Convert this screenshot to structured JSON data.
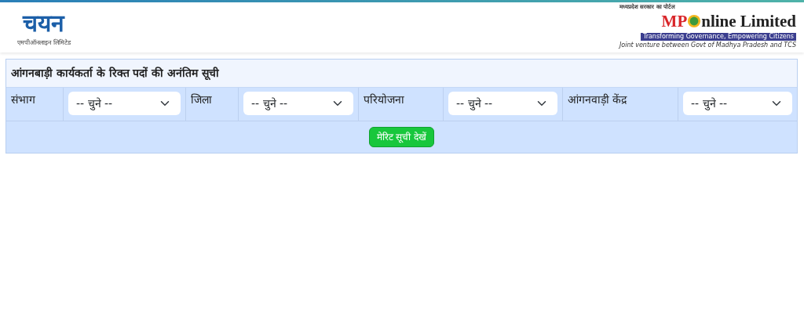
{
  "header": {
    "logo_left": {
      "wordmark": "चयन",
      "subtitle": "एमपीऑनलाइन लिमिटेड"
    },
    "logo_right": {
      "tagline_top": "मध्यप्रदेश सरकार का पोर्टल",
      "wordmark_start": "MP",
      "wordmark_end": "nline Limited",
      "slogan": "Transforming Governance, Empowering Citizens",
      "note": "Joint venture between Govt of Madhya Pradesh and TCS"
    }
  },
  "panel": {
    "title": "आंगनबाड़ी कार्यकर्ता के रिक्त पदों की अनंतिम सूची",
    "filters": [
      {
        "label": "संभाग",
        "value": "-- चुने --"
      },
      {
        "label": "जिला",
        "value": "-- चुने --"
      },
      {
        "label": "परियोजना",
        "value": "-- चुने --"
      },
      {
        "label": "आंगनवाड़ी केंद्र",
        "value": "-- चुने --"
      }
    ],
    "button": "मेरिट सूची देखें"
  }
}
